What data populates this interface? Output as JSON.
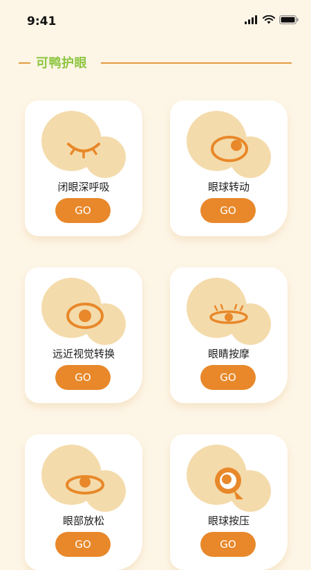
{
  "status_bar": {
    "time": "9:41"
  },
  "header": {
    "title": "可鸭护眼"
  },
  "colors": {
    "accent": "#e8882a",
    "title_green": "#8cc53f",
    "bubble": "#f4dbab",
    "background": "#fdf5e6"
  },
  "exercises": [
    {
      "label": "闭眼深呼吸",
      "icon": "closed-eye-icon",
      "button": "GO"
    },
    {
      "label": "眼球转动",
      "icon": "eye-rolling-icon",
      "button": "GO"
    },
    {
      "label": "远近视觉转换",
      "icon": "eye-focus-icon",
      "button": "GO"
    },
    {
      "label": "眼睛按摩",
      "icon": "eye-massage-icon",
      "button": "GO"
    },
    {
      "label": "眼部放松",
      "icon": "eye-relax-icon",
      "button": "GO"
    },
    {
      "label": "眼球按压",
      "icon": "eye-press-icon",
      "button": "GO"
    }
  ]
}
